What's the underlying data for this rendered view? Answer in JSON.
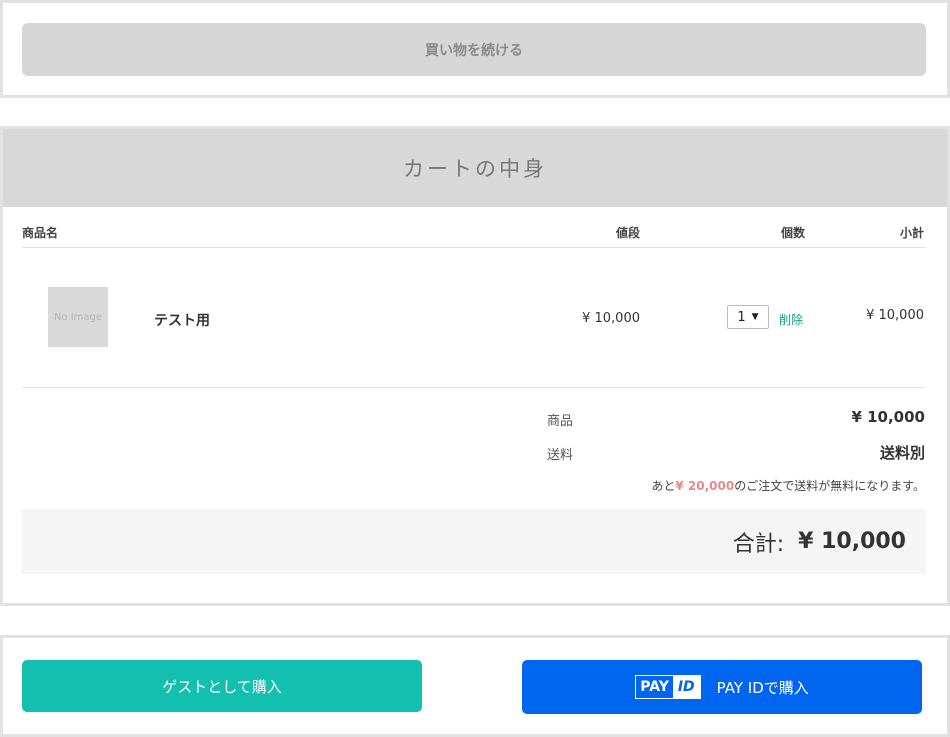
{
  "continue_button": "買い物を続ける",
  "cart": {
    "title": "カートの中身",
    "columns": {
      "name": "商品名",
      "price": "値段",
      "qty": "個数",
      "subtotal": "小計"
    },
    "items": [
      {
        "thumb": "No Image",
        "name": "テスト用",
        "price": "¥ 10,000",
        "qty": "1",
        "delete": "削除",
        "subtotal": "¥ 10,000"
      }
    ],
    "summary": {
      "goods_label": "商品",
      "goods_value": "¥ 10,000",
      "shipping_label": "送料",
      "shipping_value": "送料別",
      "note_pre": "あと",
      "note_amount": "¥ 20,000",
      "note_post": "のご注文で送料が無料になります。"
    },
    "total": {
      "label": "合計:",
      "value": "¥ 10,000"
    }
  },
  "actions": {
    "guest": "ゲストとして購入",
    "payid_logo_pay": "PAY",
    "payid_logo_id": "ID",
    "payid": "PAY IDで購入"
  },
  "colors": {
    "guest_button": "#13bfae",
    "payid_button": "#0066f0",
    "delete_link": "#1a9a86",
    "note_amount": "#e58a8a"
  }
}
